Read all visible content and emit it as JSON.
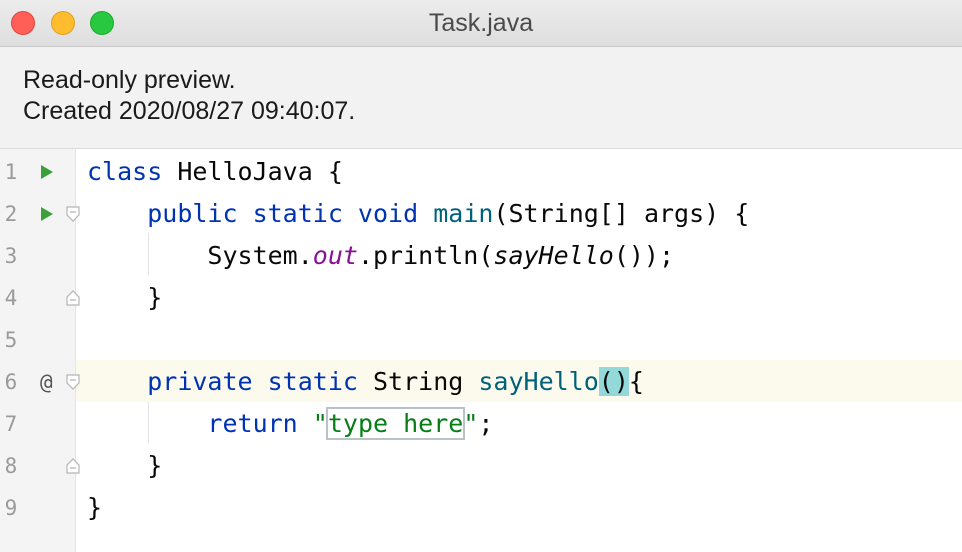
{
  "window": {
    "title": "Task.java"
  },
  "info": {
    "line1": "Read-only preview.",
    "line2": "Created 2020/08/27 09:40:07."
  },
  "editor": {
    "current_line": 6,
    "lines": [
      {
        "num": "1",
        "gutter_icon": "run-icon",
        "fold": "",
        "tokens": [
          "class",
          " HelloJava {"
        ]
      },
      {
        "num": "2",
        "gutter_icon": "run-icon",
        "fold": "fold-open-icon",
        "tokens": [
          "    ",
          "public static void",
          " ",
          "main",
          "(String[] args) {"
        ]
      },
      {
        "num": "3",
        "gutter_icon": "",
        "fold": "",
        "tokens": [
          "        System.",
          "out",
          ".println(",
          "sayHello",
          "());"
        ]
      },
      {
        "num": "4",
        "gutter_icon": "",
        "fold": "fold-close-icon",
        "tokens": [
          "    }"
        ]
      },
      {
        "num": "5",
        "gutter_icon": "",
        "fold": "",
        "tokens": []
      },
      {
        "num": "6",
        "gutter_icon": "at-icon",
        "fold": "fold-open-icon",
        "tokens": [
          "    ",
          "private static",
          " String ",
          "sayHello",
          "()",
          "{"
        ]
      },
      {
        "num": "7",
        "gutter_icon": "",
        "fold": "",
        "tokens": [
          "        ",
          "return",
          " ",
          "\"",
          "type here",
          "\"",
          ";"
        ]
      },
      {
        "num": "8",
        "gutter_icon": "",
        "fold": "fold-close-icon",
        "tokens": [
          "    }"
        ]
      },
      {
        "num": "9",
        "gutter_icon": "",
        "fold": "",
        "tokens": [
          "}"
        ]
      }
    ],
    "at_symbol": "@",
    "colors": {
      "keyword": "#0033b3",
      "method": "#00627a",
      "field": "#871094",
      "string": "#067d17",
      "paren_highlight": "#93d9d9",
      "current_line": "#fcfaed",
      "run_icon": "#3aa03a"
    }
  }
}
